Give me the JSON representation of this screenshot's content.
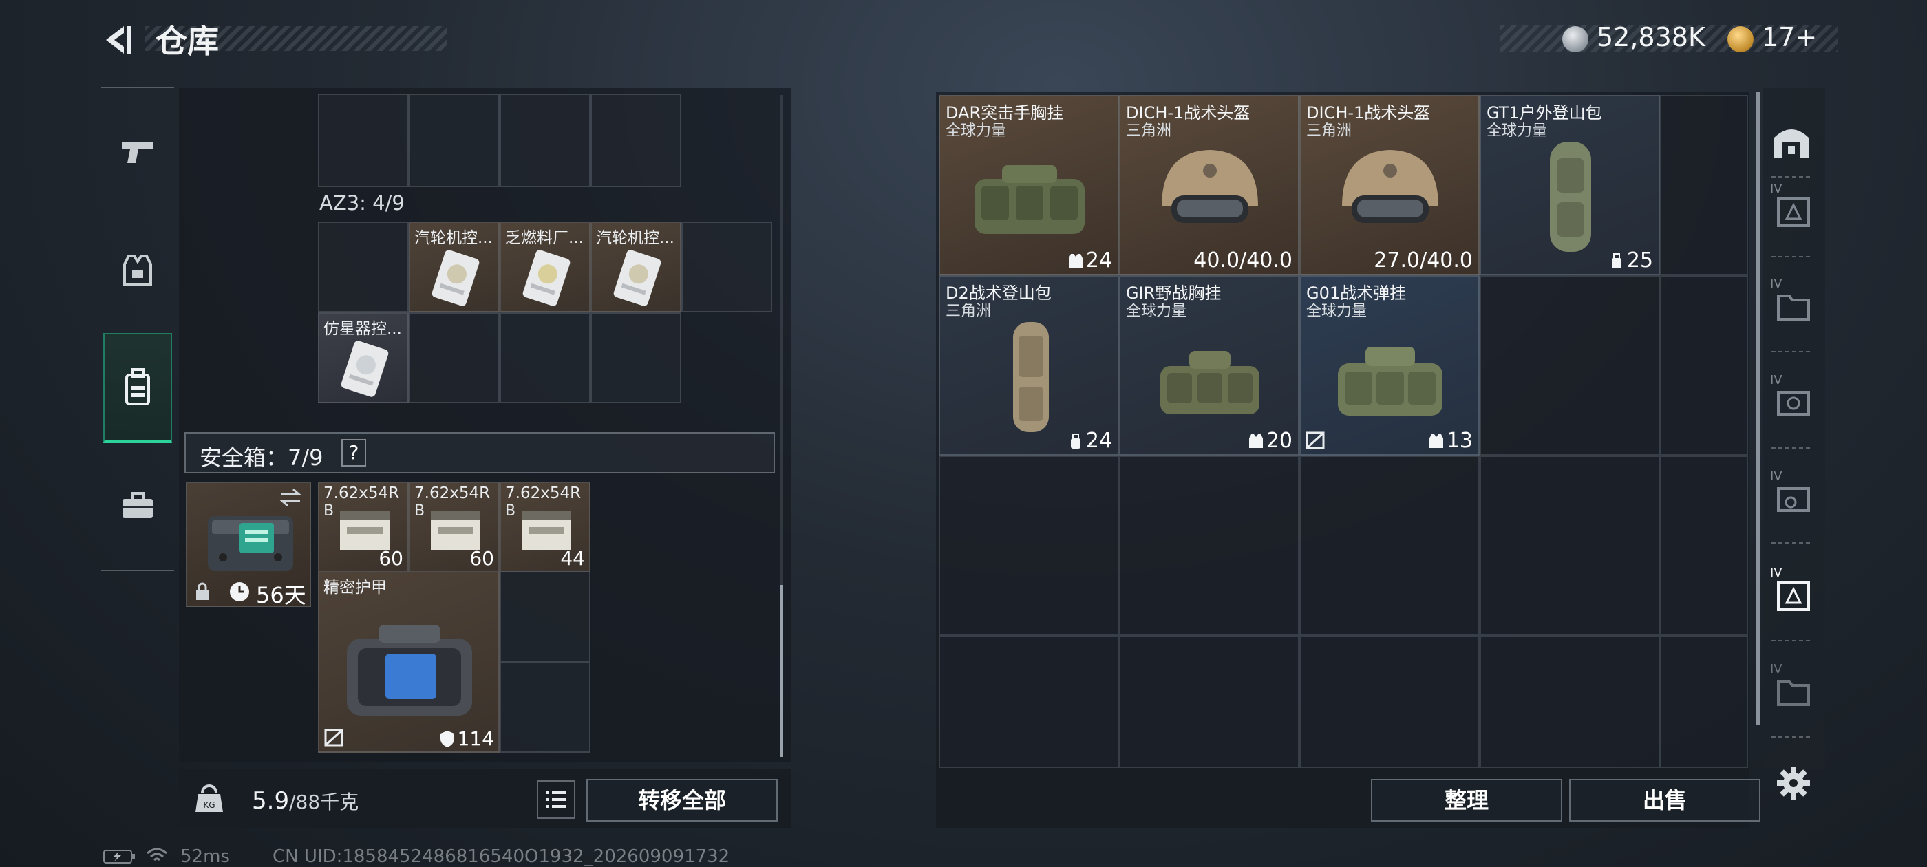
{
  "header": {
    "title": "仓库"
  },
  "currency": {
    "silver": "52,838K",
    "gold": "17+"
  },
  "left": {
    "az3_label": "AZ3: 4/9",
    "az3_items": [
      {
        "name": "汽轮机控..."
      },
      {
        "name": "乏燃料厂..."
      },
      {
        "name": "汽轮机控..."
      },
      {
        "name": "仿星器控..."
      }
    ],
    "safe_label": "安全箱：7/9",
    "safe_help": "?",
    "safebox_days": "56天",
    "ammo": [
      {
        "name": "7.62x54R",
        "sub": "B",
        "qty": "60"
      },
      {
        "name": "7.62x54R",
        "sub": "B",
        "qty": "60"
      },
      {
        "name": "7.62x54R",
        "sub": "B",
        "qty": "44"
      }
    ],
    "armor": {
      "name": "精密护甲",
      "qty": "114"
    },
    "weight_current": "5.9",
    "weight_max": "/88千克",
    "transfer_label": "转移全部"
  },
  "right": {
    "items": [
      {
        "name": "DAR突击手胸挂",
        "sub": "全球力量",
        "stat": "24"
      },
      {
        "name": "DICH-1战术头盔",
        "sub": "三角洲",
        "stat": "40.0/40.0"
      },
      {
        "name": "DICH-1战术头盔",
        "sub": "三角洲",
        "stat": "27.0/40.0"
      },
      {
        "name": "GT1户外登山包",
        "sub": "全球力量",
        "stat": "25"
      },
      {
        "name": "D2战术登山包",
        "sub": "三角洲",
        "stat": "24"
      },
      {
        "name": "GIR野战胸挂",
        "sub": "全球力量",
        "stat": "20"
      },
      {
        "name": "G01战术弹挂",
        "sub": "全球力量",
        "stat": "13"
      }
    ],
    "sort_label": "整理",
    "sell_label": "出售",
    "tab_badge": "IV"
  },
  "status": {
    "ping": "52ms",
    "uid": "CN UID:1858452486816540O1932_202609091732"
  },
  "colors": {
    "accent": "#2bd39a",
    "brown_slot": "#4f4338",
    "blue_slot": "#2e3d52"
  }
}
